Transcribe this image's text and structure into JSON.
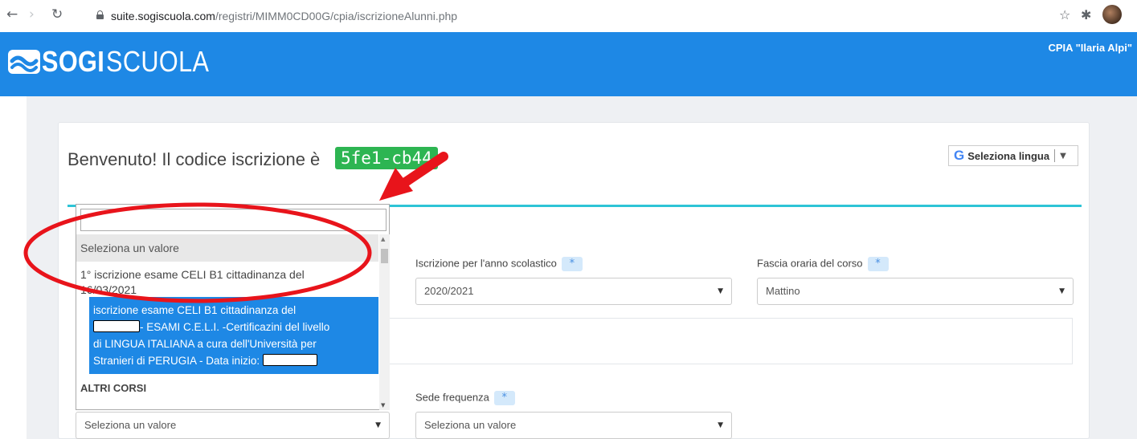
{
  "browser": {
    "url_host": "suite.sogiscuola.com",
    "url_path": "/registri/MIMM0CD00G/cpia/iscrizioneAlunni.php"
  },
  "header": {
    "logo_bold": "SOGI",
    "logo_light": "SCUOLA",
    "school_name": "CPIA \"Ilaria Alpi\""
  },
  "page": {
    "welcome_text": "Benvenuto! Il codice iscrizione è",
    "enrollment_code": "5fe1-cb44",
    "language_button": "Seleziona lingua",
    "language_icon": "G"
  },
  "fields": {
    "year_label": "Iscrizione per l'anno scolastico",
    "year_value": "2020/2021",
    "time_label": "Fascia oraria del corso",
    "time_value": "Mattino",
    "sede_label": "Sede frequenza",
    "sede_value": "Seleziona un valore",
    "bottom_left_value": "Seleziona un valore",
    "required_mark": "*"
  },
  "dropdown": {
    "search_value": "",
    "placeholder_option": "Seleziona un valore",
    "option1_line1": "1° iscrizione esame CELI B1 cittadinanza del",
    "option1_line2": "16/03/2021",
    "selected_line1": "iscrizione esame CELI B1 cittadinanza del",
    "selected_line2": "- ESAMI C.E.L.I. -Certificazini del livello",
    "selected_line3": "di LINGUA ITALIANA a cura dell'Università per",
    "selected_line4": "Stranieri di PERUGIA - Data inizio:",
    "group_label": "ALTRI CORSI"
  },
  "colors": {
    "header_blue": "#1e88e5",
    "badge_green": "#2db552",
    "teal_line": "#2ec4d6",
    "annotation_red": "#e8141b"
  },
  "icons": {
    "back": "arrow-left-icon",
    "forward": "arrow-right-icon",
    "reload": "reload-icon",
    "lock": "lock-icon",
    "star": "star-icon",
    "extensions": "puzzle-icon",
    "profile": "avatar"
  }
}
